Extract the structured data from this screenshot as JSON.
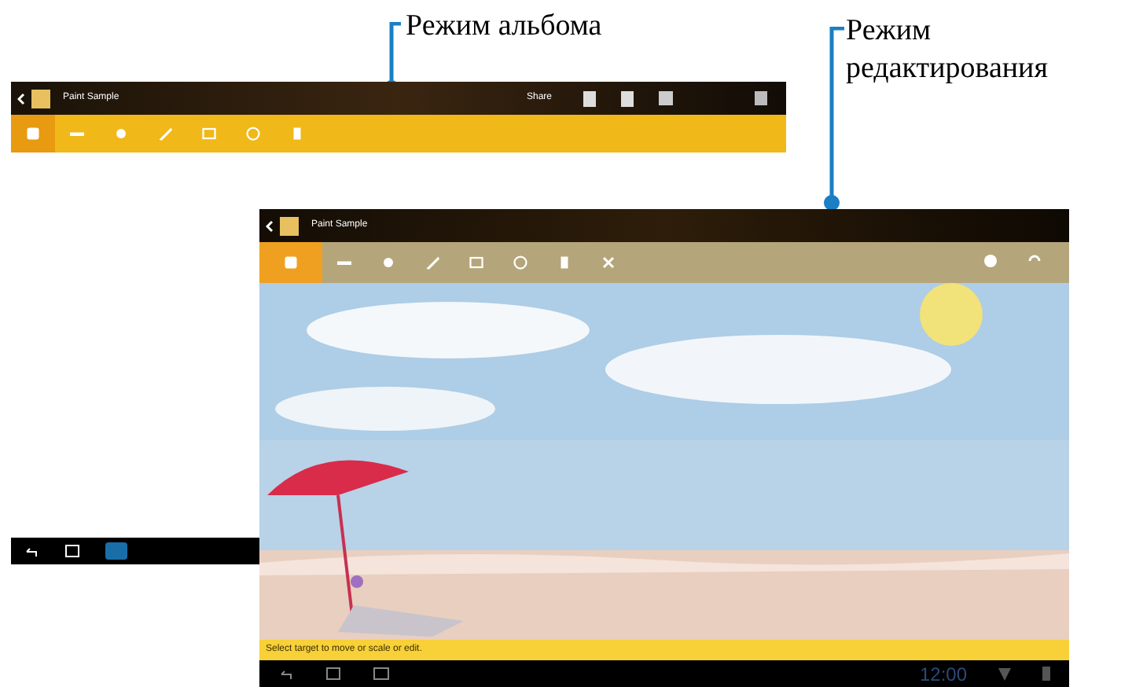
{
  "callouts": [
    {
      "text": "Режим альбома"
    },
    {
      "text": "Режим редактирования"
    }
  ],
  "album_screen": {
    "title": "Paint Sample",
    "share": "Share",
    "tools": [
      {
        "selected": true
      },
      {
        "selected": false
      },
      {
        "selected": false
      },
      {
        "selected": false
      },
      {
        "selected": false
      },
      {
        "selected": false
      },
      {
        "selected": false
      }
    ]
  },
  "edit_screen": {
    "title": "Paint Sample",
    "tools": [
      {
        "selected": true
      },
      {
        "selected": false
      },
      {
        "selected": false
      },
      {
        "selected": false
      },
      {
        "selected": false
      },
      {
        "selected": false
      },
      {
        "selected": false
      },
      {
        "selected": false
      }
    ],
    "status": "Select target to move or scale or edit.",
    "clock": "12:00"
  }
}
